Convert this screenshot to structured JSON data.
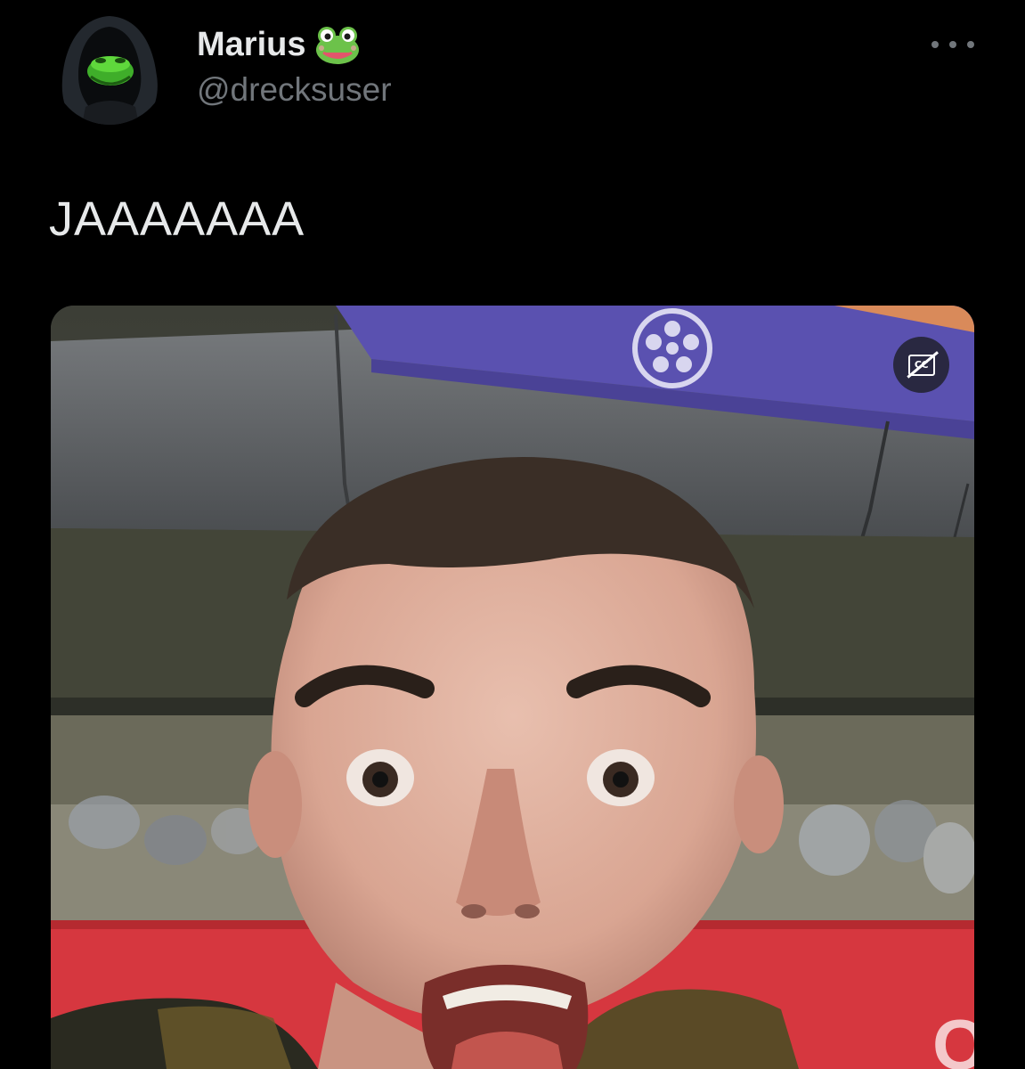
{
  "tweet": {
    "author": {
      "display_name": "Marius",
      "name_emoji": "frog-emoji",
      "handle": "@drecksuser",
      "avatar": "hooded-green-frog-avatar"
    },
    "more_menu_icon": "more-horizontal-icon",
    "text": "JAAAAAAA",
    "media": {
      "type": "video",
      "captions_button_label": "CC",
      "captions_state": "off"
    }
  },
  "colors": {
    "background": "#000000",
    "primary_text": "#e7e9ea",
    "secondary_text": "#71767b"
  }
}
